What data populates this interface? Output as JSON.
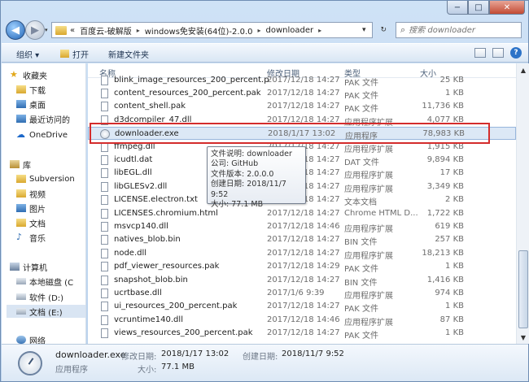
{
  "window": {
    "min_label": "−",
    "max_label": "□",
    "close_label": "✕"
  },
  "address": {
    "prefix": "«",
    "segments": [
      "百度云-破解版",
      "windows免安装(64位)-2.0.0",
      "downloader"
    ],
    "separator": "▸",
    "dropdown": "▾",
    "refresh": "↻",
    "back": "◀",
    "forward": "▶",
    "nav_dropdown": "▾"
  },
  "search": {
    "placeholder": "搜索 downloader",
    "icon": "search-icon"
  },
  "toolbar": {
    "organize": "组织 ▾",
    "open": "打开",
    "new_folder": "新建文件夹",
    "help": "?"
  },
  "nav": {
    "items": [
      {
        "label": "收藏夹",
        "icon": "star-icon"
      },
      {
        "label": "下载",
        "icon": "folder-icon"
      },
      {
        "label": "桌面",
        "icon": "desktop-icon"
      },
      {
        "label": "最近访问的",
        "icon": "recent-icon"
      },
      {
        "label": "OneDrive",
        "icon": "cloud-icon"
      },
      {
        "label": "库",
        "icon": "library-icon"
      },
      {
        "label": "Subversion",
        "icon": "folder-icon"
      },
      {
        "label": "视频",
        "icon": "video-icon"
      },
      {
        "label": "图片",
        "icon": "picture-icon"
      },
      {
        "label": "文档",
        "icon": "document-icon"
      },
      {
        "label": "音乐",
        "icon": "music-icon"
      },
      {
        "label": "计算机",
        "icon": "computer-icon"
      },
      {
        "label": "本地磁盘 (C",
        "icon": "drive-icon"
      },
      {
        "label": "软件 (D:)",
        "icon": "drive-icon"
      },
      {
        "label": "文档 (E:)",
        "icon": "drive-icon"
      },
      {
        "label": "网络",
        "icon": "network-icon"
      }
    ]
  },
  "list": {
    "columns": {
      "name": "名称",
      "date": "修改日期",
      "type": "类型",
      "size": "大小"
    },
    "rows": [
      {
        "name": "blink_image_resources_200_percent.p",
        "date": "2017/12/18 14:27",
        "type": "PAK 文件",
        "size": "25 KB"
      },
      {
        "name": "content_resources_200_percent.pak",
        "date": "2017/12/18 14:27",
        "type": "PAK 文件",
        "size": "1 KB"
      },
      {
        "name": "content_shell.pak",
        "date": "2017/12/18 14:27",
        "type": "PAK 文件",
        "size": "11,736 KB"
      },
      {
        "name": "d3dcompiler_47.dll",
        "date": "2017/12/18 14:27",
        "type": "应用程序扩展",
        "size": "4,077 KB"
      },
      {
        "name": "downloader.exe",
        "date": "2018/1/17 13:02",
        "type": "应用程序",
        "size": "78,983 KB"
      },
      {
        "name": "ffmpeg.dll",
        "date": "2017/12/18 14:27",
        "type": "应用程序扩展",
        "size": "1,915 KB"
      },
      {
        "name": "icudtl.dat",
        "date": "2017/12/18 14:27",
        "type": "DAT 文件",
        "size": "9,894 KB"
      },
      {
        "name": "libEGL.dll",
        "date": "2017/12/18 14:27",
        "type": "应用程序扩展",
        "size": "17 KB"
      },
      {
        "name": "libGLESv2.dll",
        "date": "2017/12/18 14:27",
        "type": "应用程序扩展",
        "size": "3,349 KB"
      },
      {
        "name": "LICENSE.electron.txt",
        "date": "2017/12/18 14:27",
        "type": "文本文档",
        "size": "2 KB"
      },
      {
        "name": "LICENSES.chromium.html",
        "date": "2017/12/18 14:27",
        "type": "Chrome HTML D...",
        "size": "1,722 KB"
      },
      {
        "name": "msvcp140.dll",
        "date": "2017/12/18 14:46",
        "type": "应用程序扩展",
        "size": "619 KB"
      },
      {
        "name": "natives_blob.bin",
        "date": "2017/12/18 14:27",
        "type": "BIN 文件",
        "size": "257 KB"
      },
      {
        "name": "node.dll",
        "date": "2017/12/18 14:27",
        "type": "应用程序扩展",
        "size": "18,213 KB"
      },
      {
        "name": "pdf_viewer_resources.pak",
        "date": "2017/12/18 14:29",
        "type": "PAK 文件",
        "size": "1 KB"
      },
      {
        "name": "snapshot_blob.bin",
        "date": "2017/12/18 14:27",
        "type": "BIN 文件",
        "size": "1,416 KB"
      },
      {
        "name": "ucrtbase.dll",
        "date": "2017/1/6 9:39",
        "type": "应用程序扩展",
        "size": "974 KB"
      },
      {
        "name": "ui_resources_200_percent.pak",
        "date": "2017/12/18 14:27",
        "type": "PAK 文件",
        "size": "1 KB"
      },
      {
        "name": "vcruntime140.dll",
        "date": "2017/12/18 14:46",
        "type": "应用程序扩展",
        "size": "87 KB"
      },
      {
        "name": "views_resources_200_percent.pak",
        "date": "2017/12/18 14:27",
        "type": "PAK 文件",
        "size": "1 KB"
      }
    ]
  },
  "tooltip": {
    "lines": [
      "文件说明: downloader",
      "公司: GitHub",
      "文件版本: 2.0.0.0",
      "创建日期: 2018/11/7 9:52",
      "大小: 77.1 MB"
    ]
  },
  "details": {
    "filename": "downloader.exe",
    "modified_label": "修改日期:",
    "modified": "2018/1/17 13:02",
    "created_label": "创建日期:",
    "created": "2018/11/7 9:52",
    "kind": "应用程序",
    "size_label": "大小:",
    "size": "77.1 MB"
  },
  "scroll": {
    "up": "▲",
    "down": "▼"
  }
}
